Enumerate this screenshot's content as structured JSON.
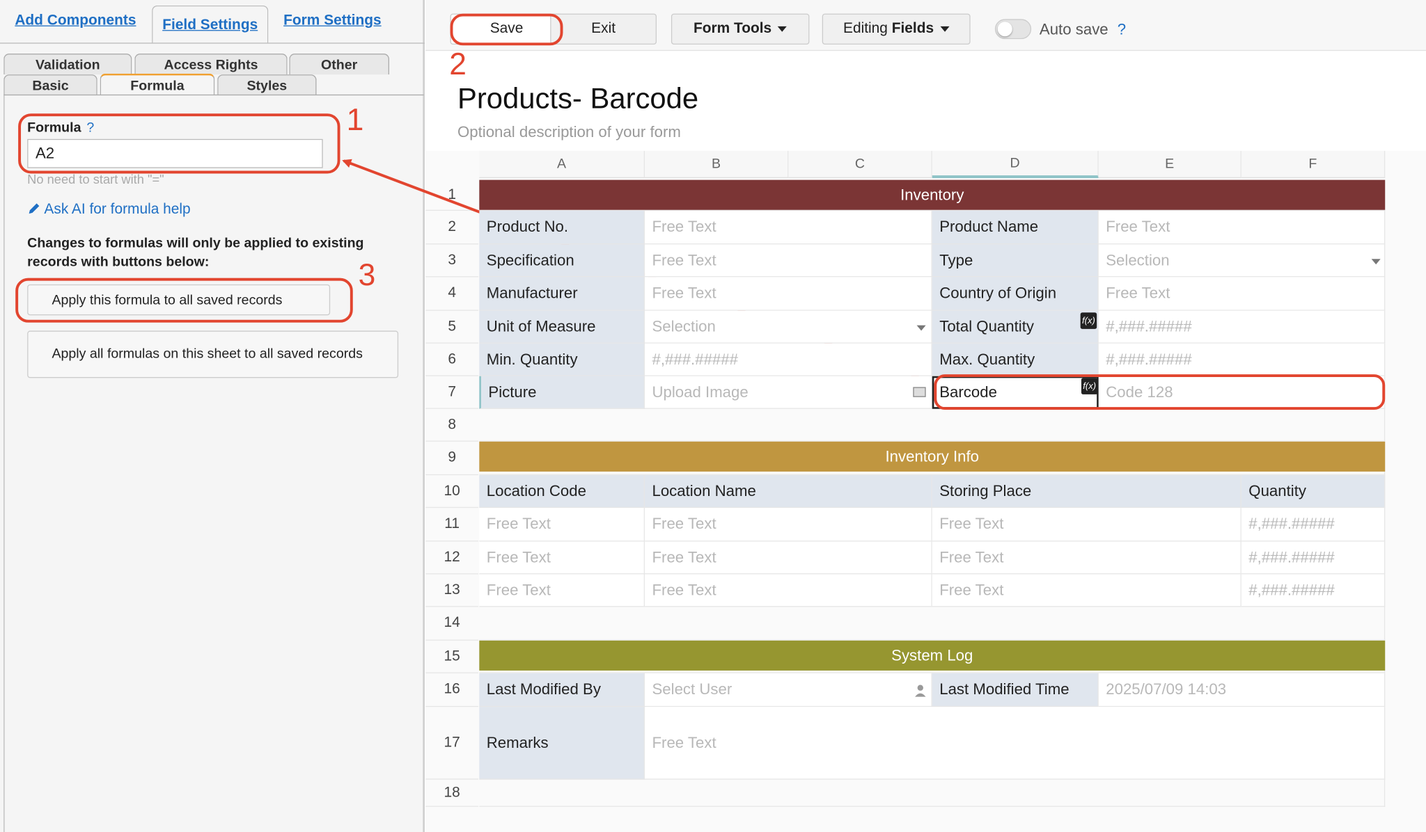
{
  "left_panel": {
    "top_tabs": [
      "Add Components",
      "Field Settings",
      "Form Settings"
    ],
    "sub_tabs_row1": [
      "Validation",
      "Access Rights",
      "Other"
    ],
    "sub_tabs_row2": [
      "Basic",
      "Formula",
      "Styles"
    ],
    "formula_label": "Formula",
    "help_mark": "?",
    "formula_value": "A2",
    "formula_hint": "No need to start with \"=\"",
    "ai_link": "Ask AI for formula help",
    "notice": "Changes to formulas will only be applied to existing records with buttons below:",
    "apply_button": "Apply this formula to all saved records",
    "apply_all_button": "Apply all formulas on this sheet to all saved records"
  },
  "annotations": [
    "1",
    "2",
    "3"
  ],
  "toolbar": {
    "save": "Save",
    "exit": "Exit",
    "form_tools": "Form Tools",
    "editing_prefix": "Editing",
    "editing_suffix": "Fields",
    "auto_save": "Auto save",
    "auto_save_help": "?",
    "auto_save_on": false
  },
  "form": {
    "title": "Products- Barcode",
    "description": "Optional description of your form"
  },
  "columns": [
    "A",
    "B",
    "C",
    "D",
    "E",
    "F"
  ],
  "selected_column": "D",
  "rows": [
    "1",
    "2",
    "3",
    "4",
    "5",
    "6",
    "7",
    "8",
    "9",
    "10",
    "11",
    "12",
    "13",
    "14",
    "15",
    "16",
    "17",
    "18"
  ],
  "banners": {
    "inventory": "Inventory",
    "inventory_info": "Inventory Info",
    "system_log": "System Log"
  },
  "banner_colors": {
    "inventory": "#7b3535",
    "inventory_info": "#c09640",
    "system_log": "#969630"
  },
  "fields": {
    "product_no": "Product No.",
    "product_no_ph": "Free Text",
    "product_name": "Product Name",
    "product_name_ph": "Free Text",
    "specification": "Specification",
    "specification_ph": "Free Text",
    "type": "Type",
    "type_ph": "Selection",
    "manufacturer": "Manufacturer",
    "manufacturer_ph": "Free Text",
    "country": "Country of Origin",
    "country_ph": "Free Text",
    "unit": "Unit of Measure",
    "unit_ph": "Selection",
    "total_qty": "Total Quantity",
    "total_qty_ph": "#,###.#####",
    "min_qty": "Min. Quantity",
    "min_qty_ph": "#,###.#####",
    "max_qty": "Max. Quantity",
    "max_qty_ph": "#,###.#####",
    "picture": "Picture",
    "picture_ph": "Upload Image",
    "barcode": "Barcode",
    "barcode_ph": "Code 128",
    "location_code": "Location Code",
    "location_name": "Location Name",
    "storing_place": "Storing Place",
    "quantity": "Quantity",
    "sub_rows": [
      [
        "Free Text",
        "Free Text",
        "Free Text",
        "#,###.#####"
      ],
      [
        "Free Text",
        "Free Text",
        "Free Text",
        "#,###.#####"
      ],
      [
        "Free Text",
        "Free Text",
        "Free Text",
        "#,###.#####"
      ]
    ],
    "last_modified_by": "Last Modified By",
    "last_modified_by_ph": "Select User",
    "last_modified_time": "Last Modified Time",
    "last_modified_time_val": "2025/07/09 14:03",
    "remarks": "Remarks",
    "remarks_ph": "Free Text",
    "fx_badge": "f(x)"
  }
}
